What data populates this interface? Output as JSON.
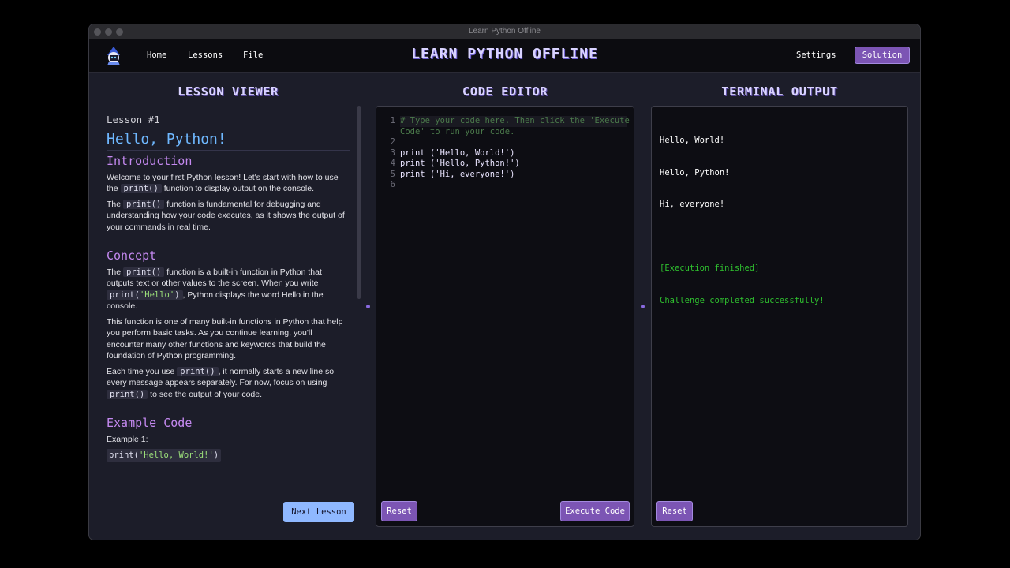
{
  "window": {
    "title": "Learn Python Offline"
  },
  "nav": {
    "items": [
      "Home",
      "Lessons",
      "File"
    ],
    "app_title": "Learn Python Offline",
    "settings_label": "Settings",
    "solution_label": "Solution"
  },
  "headings": {
    "lesson_viewer": "Lesson Viewer",
    "code_editor": "Code Editor",
    "terminal_output": "Terminal Output"
  },
  "lesson": {
    "number": "Lesson #1",
    "title": "Hello, Python!",
    "intro_heading": "Introduction",
    "intro_p1_a": "Welcome to your first Python lesson! Let's start with how to use the ",
    "intro_p1_code": "print()",
    "intro_p1_b": " function to display output on the console.",
    "intro_p2_a": "The ",
    "intro_p2_code": "print()",
    "intro_p2_b": " function is fundamental for debugging and understanding how your code executes, as it shows the output of your commands in real time.",
    "concept_heading": "Concept",
    "concept_p1_a": "The ",
    "concept_p1_code": "print()",
    "concept_p1_b": " function is a built-in function in Python that outputs text or other values to the screen. When you write ",
    "concept_p1_code2_fn": "print(",
    "concept_p1_code2_str": "'Hello'",
    "concept_p1_code2_end": ")",
    "concept_p1_c": ", Python displays the word Hello in the console.",
    "concept_p2": "This function is one of many built-in functions in Python that help you perform basic tasks. As you continue learning, you'll encounter many other functions and keywords that build the foundation of Python programming.",
    "concept_p3_a": "Each time you use ",
    "concept_p3_code": "print()",
    "concept_p3_b": ", it normally starts a new line so every message appears separately. For now, focus on using ",
    "concept_p3_code2": "print()",
    "concept_p3_c": " to see the output of your code.",
    "example_heading": "Example Code",
    "example_label": "Example 1:",
    "example_code_fn": "print(",
    "example_code_str": "'Hello, World!'",
    "example_code_end": ")",
    "next_label": "Next Lesson"
  },
  "editor": {
    "line_numbers": [
      "1",
      "",
      "2",
      "3",
      "4",
      "5",
      "6"
    ],
    "comment_l1": "# Type your code here. Then click the 'Execute",
    "comment_l2": "Code' to run your code.",
    "code_lines": [
      "print ('Hello, World!')",
      "print ('Hello, Python!')",
      "print ('Hi, everyone!')"
    ],
    "reset_label": "Reset",
    "execute_label": "Execute Code"
  },
  "terminal": {
    "output_lines": [
      "Hello, World!",
      "Hello, Python!",
      "Hi, everyone!"
    ],
    "status_lines": [
      "[Execution finished]",
      "Challenge completed successfully!"
    ],
    "reset_label": "Reset"
  }
}
